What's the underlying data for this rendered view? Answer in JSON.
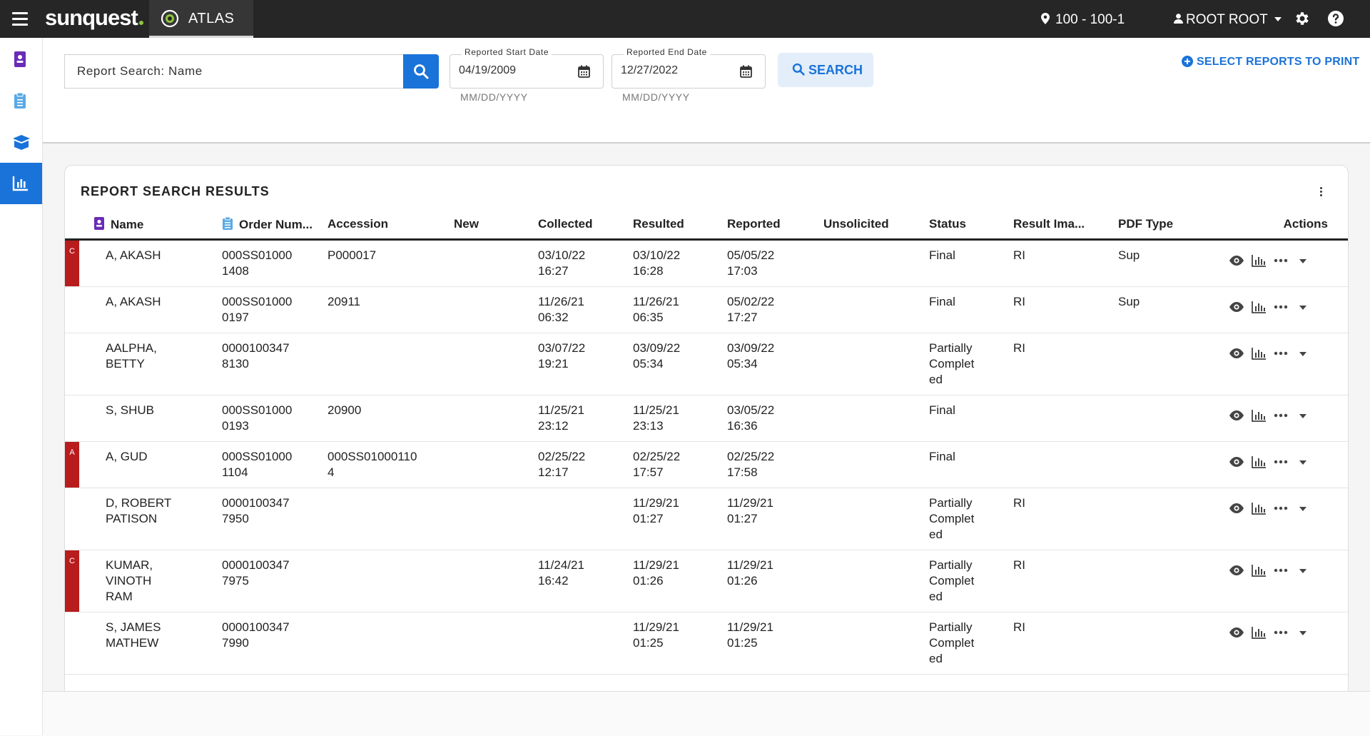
{
  "app": {
    "brand": "sunquest",
    "tab_label": "ATLAS",
    "location": "100 - 100-1",
    "user": "ROOT ROOT",
    "colors": {
      "topbar": "#262626",
      "accent": "#1a73d9",
      "flag": "#b81c1c"
    }
  },
  "nav": {
    "items": [
      {
        "name": "patient-badge-icon",
        "active": false
      },
      {
        "name": "clipboard-icon",
        "active": false
      },
      {
        "name": "package-icon",
        "active": false
      },
      {
        "name": "reports-chart-icon",
        "active": true
      }
    ]
  },
  "search": {
    "value": "Report Search: Name",
    "start_label": "Reported Start Date",
    "start_value": "04/19/2009",
    "start_hint": "MM/DD/YYYY",
    "end_label": "Reported End Date",
    "end_value": "12/27/2022",
    "end_hint": "MM/DD/YYYY",
    "search_button": "SEARCH",
    "select_print": "SELECT REPORTS TO PRINT"
  },
  "results": {
    "title": "REPORT SEARCH RESULTS",
    "columns": [
      "Name",
      "Order Num...",
      "Accession",
      "New",
      "Collected",
      "Resulted",
      "Reported",
      "Unsolicited",
      "Status",
      "Result Ima...",
      "PDF Type",
      "Actions"
    ],
    "rows": [
      {
        "flag": "C",
        "name": "A, AKASH",
        "order": "000SS01000\n1408",
        "accession": "P000017",
        "new": "",
        "collected": "03/10/22\n16:27",
        "resulted": "03/10/22\n16:28",
        "reported": "05/05/22\n17:03",
        "unsolicited": "",
        "status": "Final",
        "result_image": "RI",
        "pdf_type": "Sup"
      },
      {
        "flag": "",
        "name": "A, AKASH",
        "order": "000SS01000\n0197",
        "accession": "20911",
        "new": "",
        "collected": "11/26/21\n06:32",
        "resulted": "11/26/21\n06:35",
        "reported": "05/02/22\n17:27",
        "unsolicited": "",
        "status": "Final",
        "result_image": "RI",
        "pdf_type": "Sup"
      },
      {
        "flag": "",
        "name": "AALPHA,\nBETTY",
        "order": "0000100347\n8130",
        "accession": "",
        "new": "",
        "collected": "03/07/22\n19:21",
        "resulted": "03/09/22\n05:34",
        "reported": "03/09/22\n05:34",
        "unsolicited": "",
        "status": "Partially\nComplet\ned",
        "result_image": "RI",
        "pdf_type": ""
      },
      {
        "flag": "",
        "name": "S, SHUB",
        "order": "000SS01000\n0193",
        "accession": "20900",
        "new": "",
        "collected": "11/25/21\n23:12",
        "resulted": "11/25/21\n23:13",
        "reported": "03/05/22\n16:36",
        "unsolicited": "",
        "status": "Final",
        "result_image": "",
        "pdf_type": ""
      },
      {
        "flag": "A",
        "name": "A, GUD",
        "order": "000SS01000\n1104",
        "accession": "000SS01000110\n4",
        "new": "",
        "collected": "02/25/22\n12:17",
        "resulted": "02/25/22\n17:57",
        "reported": "02/25/22\n17:58",
        "unsolicited": "",
        "status": "Final",
        "result_image": "",
        "pdf_type": ""
      },
      {
        "flag": "",
        "name": "D, ROBERT\nPATISON",
        "order": "0000100347\n7950",
        "accession": "",
        "new": "",
        "collected": "",
        "resulted": "11/29/21\n01:27",
        "reported": "11/29/21\n01:27",
        "unsolicited": "",
        "status": "Partially\nComplet\ned",
        "result_image": "RI",
        "pdf_type": ""
      },
      {
        "flag": "C",
        "name": "KUMAR,\nVINOTH\nRAM",
        "order": "0000100347\n7975",
        "accession": "",
        "new": "",
        "collected": "11/24/21\n16:42",
        "resulted": "11/29/21\n01:26",
        "reported": "11/29/21\n01:26",
        "unsolicited": "",
        "status": "Partially\nComplet\ned",
        "result_image": "RI",
        "pdf_type": ""
      },
      {
        "flag": "",
        "name": "S, JAMES\nMATHEW",
        "order": "0000100347\n7990",
        "accession": "",
        "new": "",
        "collected": "",
        "resulted": "11/29/21\n01:25",
        "reported": "11/29/21\n01:25",
        "unsolicited": "",
        "status": "Partially\nComplet\ned",
        "result_image": "RI",
        "pdf_type": ""
      }
    ]
  }
}
